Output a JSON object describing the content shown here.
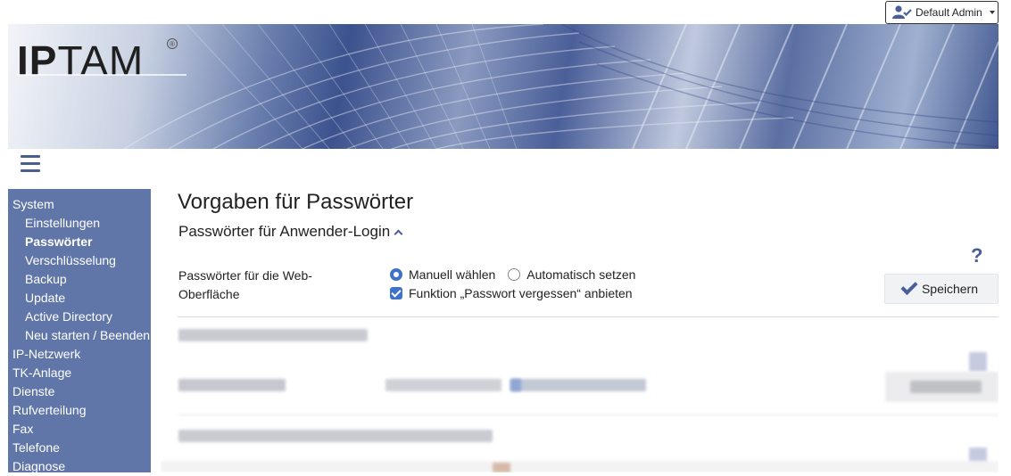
{
  "user_menu": {
    "label": "Default Admin",
    "icon": "user-check-icon"
  },
  "logo": {
    "text_bold": "IP",
    "text_regular": "TAM",
    "reg_mark": "®"
  },
  "sidebar": {
    "items": [
      {
        "label": "System",
        "level": 0,
        "active": false
      },
      {
        "label": "Einstellungen",
        "level": 1,
        "active": false
      },
      {
        "label": "Passwörter",
        "level": 1,
        "active": true
      },
      {
        "label": "Verschlüsselung",
        "level": 1,
        "active": false
      },
      {
        "label": "Backup",
        "level": 1,
        "active": false
      },
      {
        "label": "Update",
        "level": 1,
        "active": false
      },
      {
        "label": "Active Directory",
        "level": 1,
        "active": false
      },
      {
        "label": "Neu starten / Beenden",
        "level": 1,
        "active": false
      },
      {
        "label": "IP-Netzwerk",
        "level": 0,
        "active": false
      },
      {
        "label": "TK-Anlage",
        "level": 0,
        "active": false
      },
      {
        "label": "Dienste",
        "level": 0,
        "active": false
      },
      {
        "label": "Rufverteilung",
        "level": 0,
        "active": false
      },
      {
        "label": "Fax",
        "level": 0,
        "active": false
      },
      {
        "label": "Telefone",
        "level": 0,
        "active": false
      },
      {
        "label": "Diagnose",
        "level": 0,
        "active": false
      }
    ]
  },
  "main": {
    "title": "Vorgaben für Passwörter",
    "section_title": "Passwörter für Anwender-Login",
    "field_label": "Passwörter für die Web-Oberfläche",
    "radio_manual": "Manuell wählen",
    "radio_auto": "Automatisch setzen",
    "radio_selected": "manual",
    "forgot_checkbox": "Funktion „Passwort vergessen“ anbieten",
    "forgot_checked": true,
    "save_label": "Speichern",
    "help": "?"
  },
  "colors": {
    "sidebar_bg": "#6176a8",
    "accent": "#3f72c9",
    "icon": "#4a5f9a"
  }
}
